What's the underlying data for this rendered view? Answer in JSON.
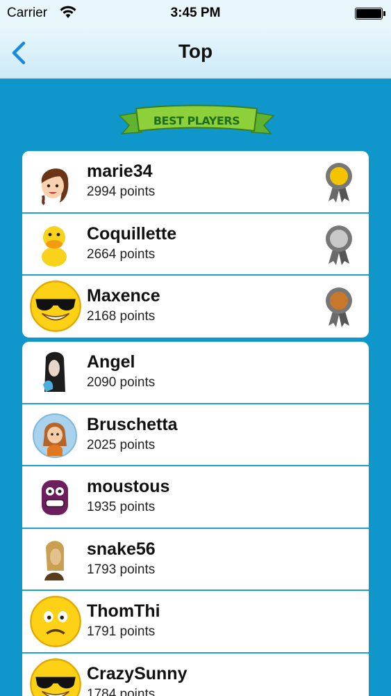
{
  "status": {
    "carrier": "Carrier",
    "time": "3:45 PM"
  },
  "nav": {
    "title": "Top",
    "back_icon": "chevron-left-icon"
  },
  "banner": {
    "text": "BEST PLAYERS"
  },
  "colors": {
    "background": "#0f97cc",
    "separator": "#1aa0d6",
    "back_accent": "#1a8ae0",
    "gold": "#f5c400",
    "silver": "#c8c8c8",
    "bronze": "#c8782a"
  },
  "top_players": [
    {
      "name": "marie34",
      "points": "2994 points",
      "avatar": "girl-avatar-icon",
      "medal": "gold"
    },
    {
      "name": "Coquillette",
      "points": "2664 points",
      "avatar": "duck-avatar-icon",
      "medal": "silver"
    },
    {
      "name": "Maxence",
      "points": "2168 points",
      "avatar": "sunglasses-smiley-icon",
      "medal": "bronze"
    }
  ],
  "other_players": [
    {
      "name": "Angel",
      "points": "2090 points",
      "avatar": "dark-hair-avatar-icon"
    },
    {
      "name": "Bruschetta",
      "points": "2025 points",
      "avatar": "girl-circle-avatar-icon"
    },
    {
      "name": "moustous",
      "points": "1935 points",
      "avatar": "purple-monster-icon"
    },
    {
      "name": "snake56",
      "points": "1793 points",
      "avatar": "blonde-avatar-icon"
    },
    {
      "name": "ThomThi",
      "points": "1791 points",
      "avatar": "frown-smiley-icon"
    },
    {
      "name": "CrazySunny",
      "points": "1784 points",
      "avatar": "sunglasses-smiley-icon"
    }
  ]
}
